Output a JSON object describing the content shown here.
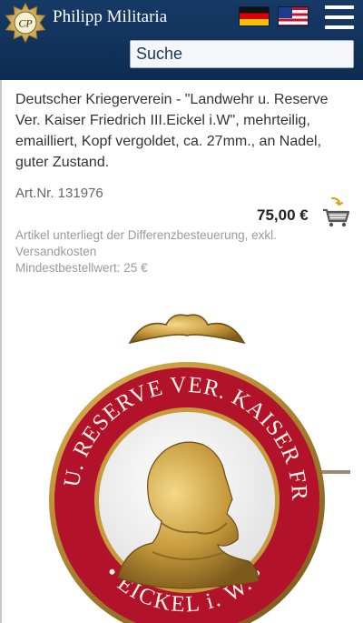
{
  "header": {
    "brand": "Philipp Militaria",
    "logo_monogram": "CP",
    "search_value": "Suche"
  },
  "icons": [
    "logo-emblem-icon",
    "flag-de-icon",
    "flag-us-icon",
    "menu-icon",
    "cart-icon"
  ],
  "colors": {
    "header": "#143864",
    "price": "#222222",
    "note": "#9a9a9a",
    "badge_red": "#b3122b",
    "badge_gold": "#c79a3c"
  },
  "product": {
    "title": "Deutscher Kriegerverein - \"Landwehr u. Reserve Ver. Kaiser Friedrich III.Eickel i.W\", mehrteilig, emailliert, Kopf vergoldet, ca. 27mm., an Nadel, guter Zustand.",
    "art_nr": "Art.Nr. 131976",
    "price": "75,00 €",
    "tax_note": "Artikel unterliegt der Differenzbesteuerung, exkl. Versandkosten",
    "min_order": "Mindestbestellwert: 25 €"
  },
  "badge": {
    "ring_text_top": "LANDWEHR U. RESERVE VER. KAISER FRIEDRICH III",
    "ring_text_bottom": "• EICKEL i. W. •"
  }
}
